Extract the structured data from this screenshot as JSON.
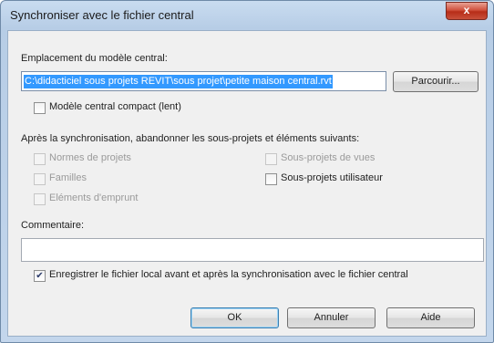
{
  "window": {
    "title": "Synchroniser avec le fichier central",
    "close_label": "x"
  },
  "location": {
    "label": "Emplacement du modèle central:",
    "path": "C:\\didacticiel sous projets REVIT\\sous projet\\petite maison central.rvt",
    "browse_label": "Parcourir..."
  },
  "compact": {
    "label": "Modèle central compact (lent)",
    "checked": false
  },
  "relinquish": {
    "heading": "Après la synchronisation, abandonner les sous-projets et éléments suivants:",
    "options": [
      {
        "label": "Normes de projets",
        "checked": false,
        "enabled": false
      },
      {
        "label": "Familles",
        "checked": false,
        "enabled": false
      },
      {
        "label": "Eléments d'emprunt",
        "checked": false,
        "enabled": false
      },
      {
        "label": "Sous-projets de vues",
        "checked": false,
        "enabled": false
      },
      {
        "label": "Sous-projets utilisateur",
        "checked": false,
        "enabled": true
      }
    ]
  },
  "comment": {
    "label": "Commentaire:",
    "value": ""
  },
  "save_local": {
    "label": "Enregistrer le fichier local avant et après la synchronisation avec le fichier central",
    "checked": true
  },
  "buttons": {
    "ok": "OK",
    "cancel": "Annuler",
    "help": "Aide"
  }
}
